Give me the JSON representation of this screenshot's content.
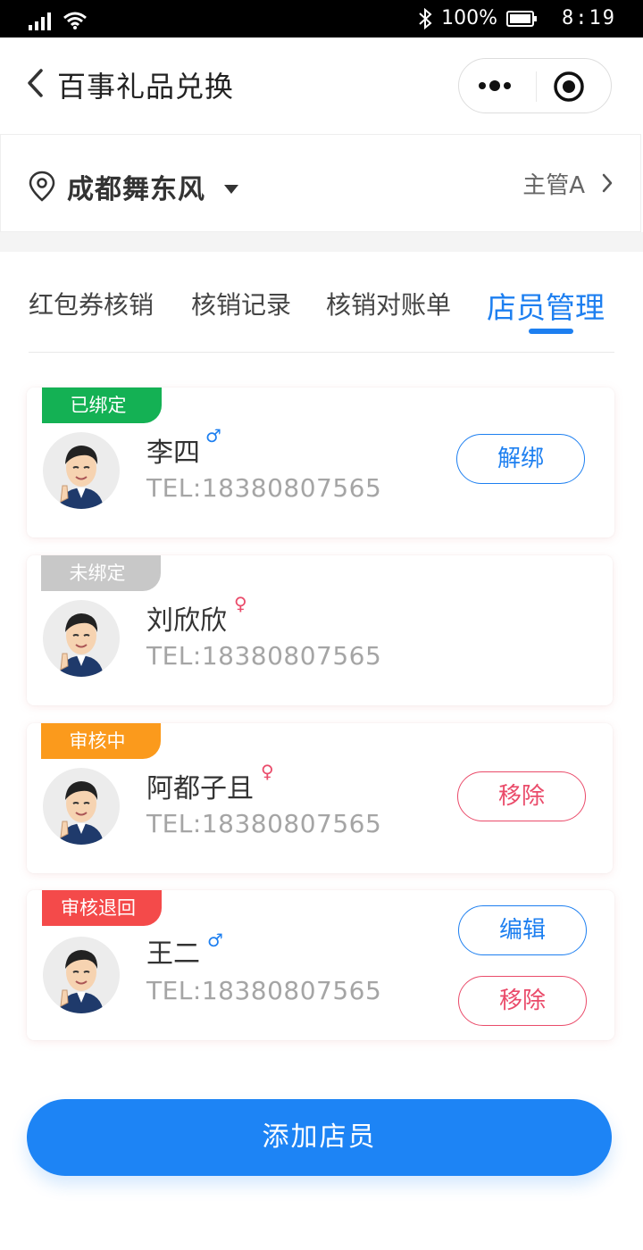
{
  "status_bar": {
    "battery": "100%",
    "time": "8:19"
  },
  "nav": {
    "title": "百事礼品兑换"
  },
  "store": {
    "name": "成都舞东风",
    "manager": "主管A"
  },
  "tabs": [
    {
      "label": "红包券核销",
      "active": false
    },
    {
      "label": "核销记录",
      "active": false
    },
    {
      "label": "核销对账单",
      "active": false
    },
    {
      "label": "店员管理",
      "active": true
    }
  ],
  "employees": [
    {
      "status": "已绑定",
      "status_color": "#14b154",
      "name": "李四",
      "gender": "♂",
      "gender_color": "#1d7ff0",
      "tel": "TEL:18380807565",
      "actions": [
        "解绑"
      ]
    },
    {
      "status": "未绑定",
      "status_color": "#c8c8c8",
      "name": "刘欣欣",
      "gender": "♀",
      "gender_color": "#ea4b6a",
      "tel": "TEL:18380807565",
      "actions": []
    },
    {
      "status": "审核中",
      "status_color": "#fb9a1c",
      "name": "阿都子且",
      "gender": "♀",
      "gender_color": "#ea4b6a",
      "tel": "TEL:18380807565",
      "actions": [
        "移除"
      ]
    },
    {
      "status": "审核退回",
      "status_color": "#f44a4a",
      "name": "王二",
      "gender": "♂",
      "gender_color": "#1d7ff0",
      "tel": "TEL:18380807565",
      "actions": [
        "编辑",
        "移除"
      ]
    }
  ],
  "add_button": "添加店员"
}
